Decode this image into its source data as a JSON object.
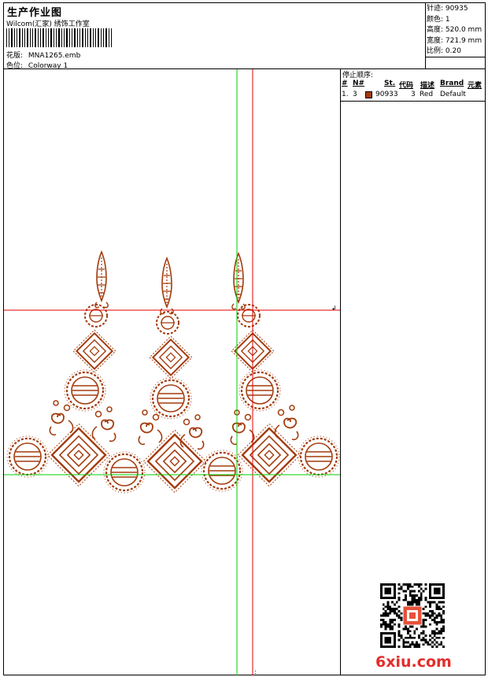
{
  "header": {
    "title": "生产作业图",
    "studio": "Wilcom(汇家) 绣饰工作室",
    "design_label": "花版:",
    "design_file": "MNA1265.emb",
    "colorway_label": "色位:",
    "colorway": "Colorway 1"
  },
  "stats": [
    {
      "label": "针迹:",
      "value": "90935"
    },
    {
      "label": "颜色:",
      "value": "1"
    },
    {
      "label": "高度:",
      "value": "520.0 mm"
    },
    {
      "label": "宽度:",
      "value": "721.9 mm"
    },
    {
      "label": "比例:",
      "value": "0.20"
    }
  ],
  "stop_sequence": {
    "title": "停止顺序:",
    "headers": [
      "#",
      "N#",
      "St.",
      "代码",
      "描述",
      "Brand",
      "元素"
    ],
    "rows": [
      {
        "num": "1.",
        "needle": "3",
        "stitches": "90933",
        "code": "3",
        "desc": "Red",
        "brand": "Default",
        "swatch": "#a33b0d"
      }
    ]
  },
  "colors": {
    "embroidery": "#a33b0d",
    "guide_red": "#e00000",
    "guide_green": "#00cc00"
  },
  "watermark": "6xiu.com"
}
